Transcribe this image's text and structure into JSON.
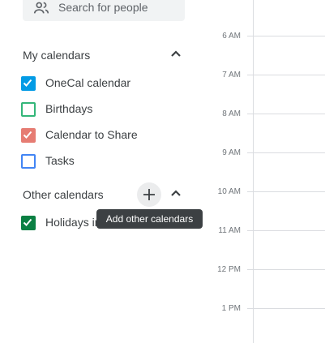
{
  "search": {
    "placeholder_text": "Search for people",
    "icon": "people-icon"
  },
  "my_calendars": {
    "title": "My calendars",
    "collapse_icon": "chevron-up-icon",
    "items": [
      {
        "label": "OneCal calendar",
        "checked": true,
        "color": "#039be5"
      },
      {
        "label": "Birthdays",
        "checked": false,
        "color": "#33b679"
      },
      {
        "label": "Calendar to Share",
        "checked": true,
        "color": "#e67c73"
      },
      {
        "label": "Tasks",
        "checked": false,
        "color": "#4285f4"
      }
    ]
  },
  "other_calendars": {
    "title": "Other calendars",
    "add_icon": "plus-icon",
    "collapse_icon": "chevron-up-icon",
    "items": [
      {
        "label": "Holidays in",
        "checked": true,
        "color": "#0b8043"
      }
    ]
  },
  "tooltip": {
    "text": "Add other calendars"
  },
  "time_grid": {
    "hours": [
      "6 AM",
      "7 AM",
      "8 AM",
      "9 AM",
      "10 AM",
      "11 AM",
      "12 PM",
      "1 PM"
    ]
  }
}
